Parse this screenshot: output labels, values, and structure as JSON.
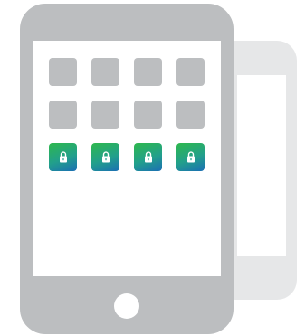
{
  "colors": {
    "device_frame": "#bcbec0",
    "back_device_frame": "#e6e7e8",
    "screen": "#ffffff",
    "app_tile": "#bcbec0",
    "lock_tile_gradient": [
      "#2eb84d",
      "#22a08b",
      "#1b6fb4"
    ],
    "lock_glyph": "#ffffff"
  },
  "screen": {
    "grid": {
      "columns": 4,
      "rows": [
        {
          "kind": "app",
          "count": 4
        },
        {
          "kind": "app",
          "count": 4
        },
        {
          "kind": "locked-app",
          "count": 4,
          "icon": "lock-icon"
        }
      ]
    }
  },
  "home_button": {
    "icon": "home-button-circle"
  }
}
